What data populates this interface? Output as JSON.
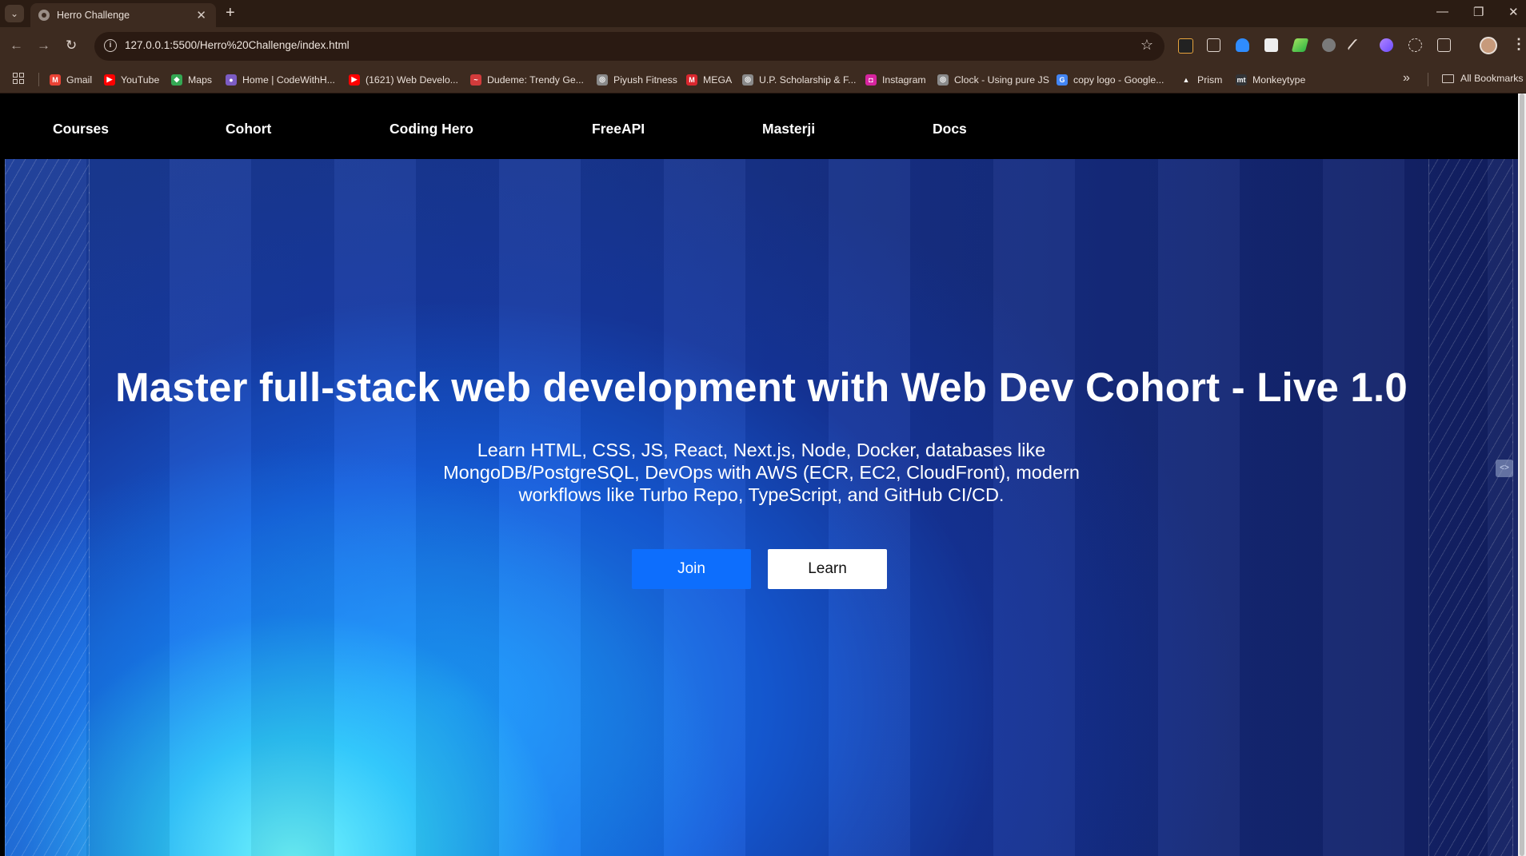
{
  "browser": {
    "tab_title": "Herro Challenge",
    "url": "127.0.0.1:5500/Herro%20Challenge/index.html",
    "bookmarks": [
      {
        "label": "Gmail",
        "icon": "gmail-icon",
        "color": "#ea4335",
        "glyph": "M"
      },
      {
        "label": "YouTube",
        "icon": "youtube-icon",
        "color": "#ff0000",
        "glyph": "▶"
      },
      {
        "label": "Maps",
        "icon": "maps-icon",
        "color": "#34a853",
        "glyph": "◆"
      },
      {
        "label": "Home | CodeWithH...",
        "icon": "codewithharry-icon",
        "color": "#7c5cc4",
        "glyph": "●"
      },
      {
        "label": "(1621) Web Develo...",
        "icon": "youtube-icon",
        "color": "#ff0000",
        "glyph": "▶"
      },
      {
        "label": "Dudeme: Trendy Ge...",
        "icon": "dudeme-icon",
        "color": "#d23b3b",
        "glyph": "~"
      },
      {
        "label": "Piyush Fitness",
        "icon": "globe-icon",
        "color": "#8a8a8a",
        "glyph": "◎"
      },
      {
        "label": "MEGA",
        "icon": "mega-icon",
        "color": "#d9272e",
        "glyph": "M"
      },
      {
        "label": "U.P. Scholarship & F...",
        "icon": "globe-icon",
        "color": "#8a8a8a",
        "glyph": "◎"
      },
      {
        "label": "Instagram",
        "icon": "instagram-icon",
        "color": "#d6249f",
        "glyph": "◘"
      },
      {
        "label": "Clock - Using pure JS",
        "icon": "globe-icon",
        "color": "#8a8a8a",
        "glyph": "◎"
      },
      {
        "label": "copy logo - Google...",
        "icon": "google-icon",
        "color": "#4285f4",
        "glyph": "G"
      },
      {
        "label": "Prism",
        "icon": "prism-icon",
        "color": "#3d2b20",
        "glyph": "▲"
      },
      {
        "label": "Monkeytype",
        "icon": "monkeytype-icon",
        "color": "#323437",
        "glyph": "mt"
      }
    ],
    "all_bookmarks": "All Bookmarks"
  },
  "site": {
    "nav": [
      "Courses",
      "Cohort",
      "Coding Hero",
      "FreeAPI",
      "Masterji",
      "Docs"
    ],
    "hero": {
      "title": "Master full-stack web development with Web Dev Cohort - Live 1.0",
      "subtitle": "Learn HTML, CSS, JS, React, Next.js, Node, Docker, databases like MongoDB/PostgreSQL, DevOps with AWS (ECR, EC2, CloudFront), modern workflows like Turbo Repo, TypeScript, and GitHub CI/CD.",
      "join_label": "Join",
      "learn_label": "Learn"
    }
  },
  "colors": {
    "join_button": "#0d6efd",
    "nav_background": "#000000",
    "hero_glow": "#73ffff"
  }
}
